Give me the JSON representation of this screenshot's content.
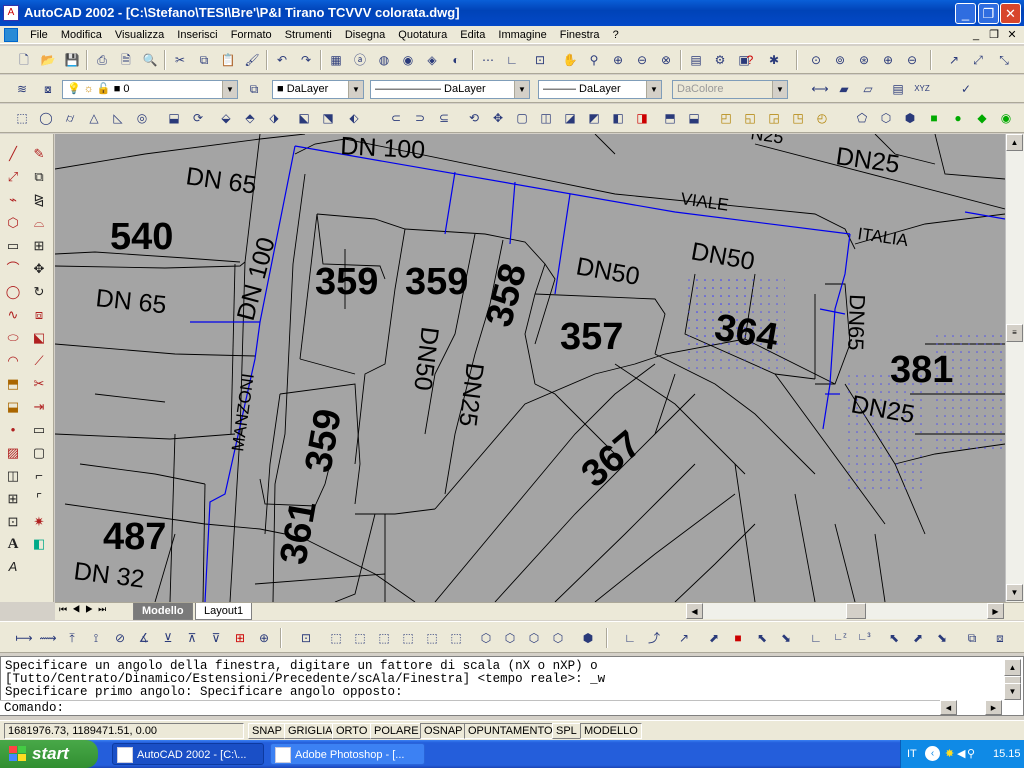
{
  "window": {
    "title": "AutoCAD 2002 - [C:\\Stefano\\TESI\\Bre'\\P&I Tirano TCVVV colorata.dwg]",
    "minimize": "_",
    "restore": "❐",
    "close": "✕"
  },
  "menu": [
    "File",
    "Modifica",
    "Visualizza",
    "Inserisci",
    "Formato",
    "Strumenti",
    "Disegna",
    "Quotatura",
    "Edita",
    "Immagine",
    "Finestra",
    "?"
  ],
  "layers": {
    "current_layer": "0",
    "color": "DaLayer",
    "linetype": "—————— DaLayer",
    "lineweight": "——— DaLayer",
    "plotstyle": "DaColore"
  },
  "drawing": {
    "labels": {
      "dn100_top": "DN 100",
      "dn65_a": "DN 65",
      "dn100_vert": "DN 100",
      "dn65_b": "DN 65",
      "dn25_topright": "DN25",
      "viale": "VIALE",
      "italia": "ITALIA",
      "manzoni": "MANZONI",
      "dn50_a": "DN50",
      "dn50_b": "DN50",
      "dn50_vert": "DN50",
      "dn25_vert": "DN25",
      "dn65_vert": "DN65",
      "dn25_right": "DN25",
      "dn32": "DN 32",
      "n25_cut": "N25"
    },
    "parcels": {
      "p540": "540",
      "p359a": "359",
      "p359b": "359",
      "p358": "358",
      "p357": "357",
      "p364": "364",
      "p381": "381",
      "p359c": "359",
      "p367": "367",
      "p487": "487",
      "p361": "361"
    }
  },
  "tabs": {
    "model": "Modello",
    "layout1": "Layout1"
  },
  "command": {
    "line1": "Specificare un angolo della finestra, digitare un fattore di scala (nX o nXP) o",
    "line2": "[Tutto/Centrato/Dinamico/Estensioni/Precedente/scAla/Finestra] <tempo reale>: _w",
    "line3": "Specificare primo angolo: Specificare angolo opposto:",
    "prompt": "Comando:"
  },
  "status": {
    "coords": "1681976.73, 1189471.51, 0.00",
    "toggles": [
      "SNAP",
      "GRIGLIA",
      "ORTO",
      "POLARE",
      "OSNAP",
      "OPUNTAMENTO",
      "SPL",
      "MODELLO"
    ]
  },
  "taskbar": {
    "start": "start",
    "task1": "AutoCAD 2002 - [C:\\...",
    "task2": "Adobe Photoshop - [...",
    "lang": "IT",
    "clock": "15.15"
  },
  "colors": {
    "pipe": "#0000ee",
    "drawing_bg": "#a4a4a4",
    "titlebar": "#0a5fd8"
  },
  "icons": [
    "new-icon",
    "open-icon",
    "save-icon",
    "print-icon",
    "preview-icon",
    "cut-icon",
    "copy-icon",
    "paste-icon",
    "undo-icon",
    "redo-icon",
    "zoom-icon",
    "pan-icon",
    "help-icon",
    "line-icon",
    "circle-icon",
    "move-icon",
    "text-icon"
  ]
}
